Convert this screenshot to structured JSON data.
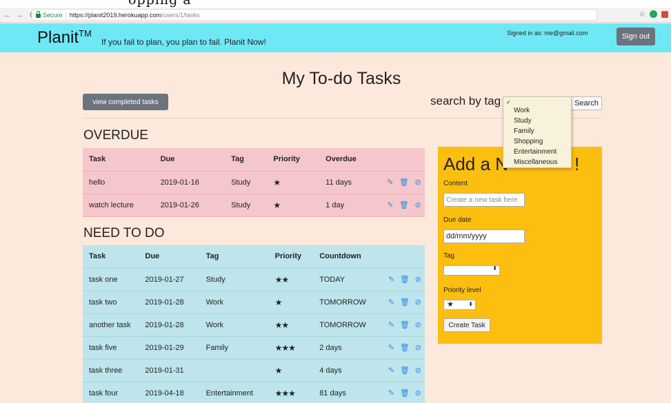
{
  "browser": {
    "secure_label": "Secure",
    "url_host": "https://planit2019.herokuapp.com",
    "url_path": "/users/1/tasks"
  },
  "header": {
    "brand": "Planit",
    "trademark": "TM",
    "motto": "If you fail to plan, you plan to fail. Planit Now!",
    "signed_in": "Signed in as: me@gmail.com",
    "signout": "Sign out"
  },
  "page_title": "My To-do Tasks",
  "view_completed": "view completed tasks",
  "search": {
    "label": "search by tag",
    "button": "Search",
    "options": [
      "Work",
      "Study",
      "Family",
      "Shopping",
      "Entertainment",
      "Miscellaneous"
    ]
  },
  "overdue": {
    "title": "OVERDUE",
    "headers": [
      "Task",
      "Due",
      "Tag",
      "Priority",
      "Overdue"
    ],
    "rows": [
      {
        "task": "hello",
        "due": "2019-01-16",
        "tag": "Study",
        "priority": "★",
        "status": "11 days"
      },
      {
        "task": "watch lecture",
        "due": "2019-01-26",
        "tag": "Study",
        "priority": "★",
        "status": "1 day"
      }
    ]
  },
  "todo": {
    "title": "NEED TO DO",
    "headers": [
      "Task",
      "Due",
      "Tag",
      "Priority",
      "Countdown"
    ],
    "rows": [
      {
        "task": "task one",
        "due": "2019-01-27",
        "tag": "Study",
        "priority": "★★",
        "status": "TODAY"
      },
      {
        "task": "task two",
        "due": "2019-01-28",
        "tag": "Work",
        "priority": "★",
        "status": "TOMORROW"
      },
      {
        "task": "another task",
        "due": "2019-01-28",
        "tag": "Work",
        "priority": "★★",
        "status": "TOMORROW"
      },
      {
        "task": "task five",
        "due": "2019-01-29",
        "tag": "Family",
        "priority": "★★★",
        "status": "2 days"
      },
      {
        "task": "task three",
        "due": "2019-01-31",
        "tag": "",
        "priority": "★",
        "status": "4 days"
      },
      {
        "task": "task four",
        "due": "2019-04-18",
        "tag": "Entertainment",
        "priority": "★★★",
        "status": "81 days"
      }
    ]
  },
  "add_panel": {
    "title": "Add a N",
    "title_tail": "!",
    "content_label": "Content",
    "content_placeholder": "Create a new task here",
    "due_label": "Due date",
    "due_placeholder": "dd/mm/yyyy",
    "tag_label": "Tag",
    "priority_label": "Priority level",
    "priority_value": "★",
    "create_button": "Create Task"
  },
  "icons": {
    "edit": "edit-icon",
    "delete": "trash-icon",
    "complete": "check-circle-icon"
  },
  "colors": {
    "header": "#6ee8f5",
    "overdue": "#f5c6cb",
    "todo": "#bde5eb",
    "add_panel": "#fdbf0f",
    "action_icon": "#2f8de4"
  }
}
